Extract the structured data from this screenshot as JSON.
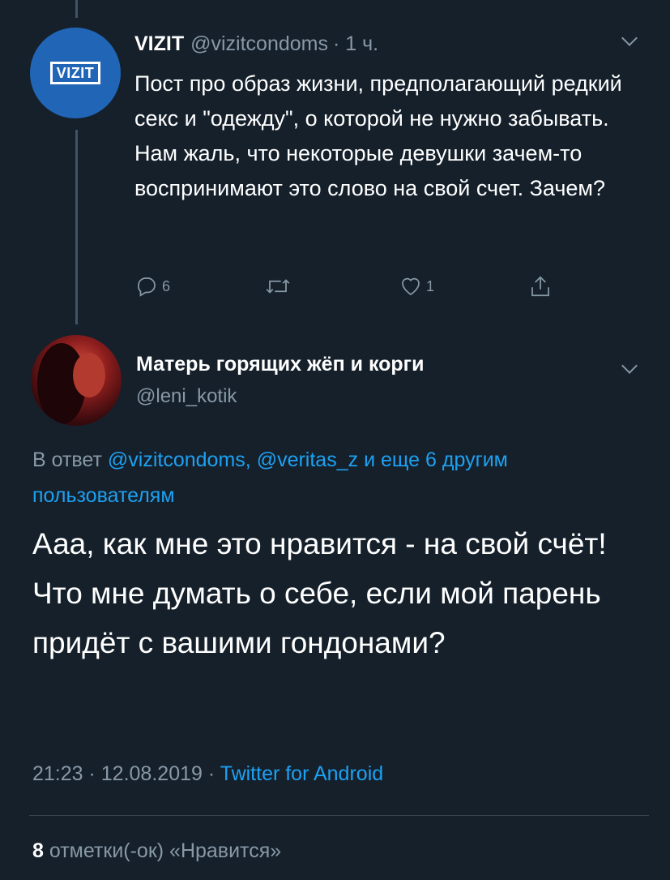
{
  "tweet1": {
    "display_name": "VIZIT",
    "handle": "@vizitcondoms",
    "time": "· 1 ч.",
    "avatar_logo_text": "VIZIT",
    "text": "Пост про образ жизни, предполагающий редкий секс и \"одежду\", о которой не нужно забывать. Нам жаль, что некоторые девушки зачем-то воспринимают это слово на свой счет. Зачем?",
    "reply_count": "6",
    "like_count": "1",
    "icons": [
      "reply-icon",
      "retweet-icon",
      "like-icon",
      "share-icon",
      "chevron-down-icon"
    ]
  },
  "tweet2": {
    "display_name": "Матерь горящих жёп и корги",
    "handle": "@leni_kotik",
    "reply_prefix": "В ответ",
    "reply_to_1": "@vizitcondoms,",
    "reply_to_2": "@veritas_z",
    "reply_suffix": "и еще 6 другим пользователям",
    "text": "Ааа, как мне это нравится - на свой счёт! Что мне думать о себе, если мой парень придёт с вашими гондонами?",
    "timestamp": "21:23 · 12.08.2019 ·",
    "client": "Twitter for Android",
    "likes_count": "8",
    "likes_label": "отметки(-ок) «Нравится»"
  },
  "colors": {
    "background": "#15202b",
    "secondary_text": "#8899a6",
    "link": "#1da1f2",
    "vizit_brand": "#2165b7"
  }
}
